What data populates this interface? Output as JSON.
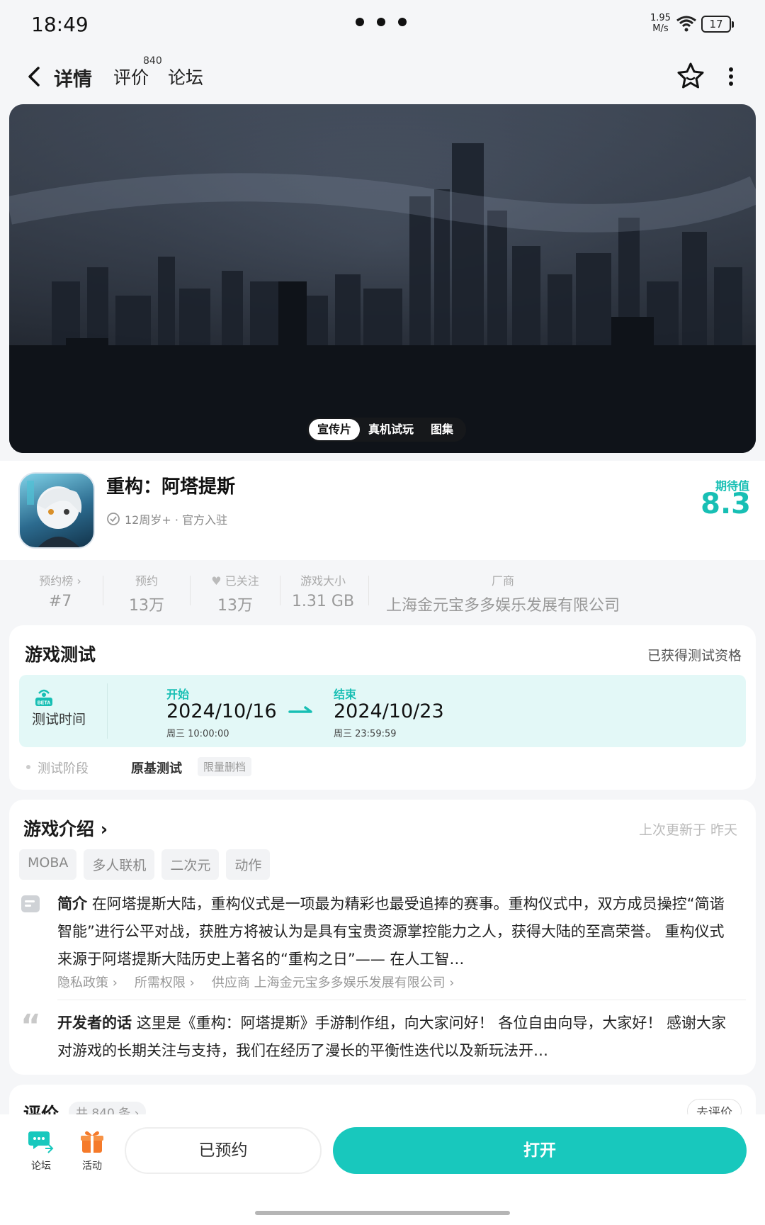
{
  "status": {
    "time": "18:49",
    "net_speed_top": "1.95",
    "net_speed_bottom": "M/s",
    "battery": "17"
  },
  "nav": {
    "tab_detail": "详情",
    "tab_review": "评价",
    "review_count": "840",
    "tab_forum": "论坛"
  },
  "hero": {
    "chips": [
      "宣传片",
      "真机试玩",
      "图集"
    ]
  },
  "game": {
    "name": "重构：阿塔提斯",
    "meta": "12周岁+ · 官方入驻",
    "expect_label": "期待值",
    "expect_score": "8.3"
  },
  "stats": [
    {
      "label": "预约榜 ›",
      "value": "#7"
    },
    {
      "label": "预约",
      "value": "13万"
    },
    {
      "label": "已关注",
      "value": "13万"
    },
    {
      "label": "游戏大小",
      "value": "1.31 GB"
    },
    {
      "label": "厂商",
      "value": "上海金元宝多多娱乐发展有限公司"
    }
  ],
  "test": {
    "title": "游戏测试",
    "qualification": "已获得测试资格",
    "time_label": "测试时间",
    "start_label": "开始",
    "start_date": "2024/10/16",
    "start_sub": "周三  10:00:00",
    "end_label": "结束",
    "end_date": "2024/10/23",
    "end_sub": "周三  23:59:59",
    "phase_label": "测试阶段",
    "phase_value": "原基测试",
    "phase_tag": "限量删档"
  },
  "intro": {
    "title": "游戏介绍 ›",
    "updated": "上次更新于 昨天",
    "tags": [
      "MOBA",
      "多人联机",
      "二次元",
      "动作"
    ],
    "summary_label": "简介",
    "summary_text": "在阿塔提斯大陆，重构仪式是一项最为精彩也最受追捧的赛事。重构仪式中，双方成员操控“简谐智能”进行公平对战，获胜方将被认为是具有宝贵资源掌控能力之人，获得大陆的至高荣誉。 重构仪式来源于阿塔提斯大陆历史上著名的“重构之日”—— 在人工智…",
    "links": [
      "隐私政策 ›",
      "所需权限 ›",
      "供应商 上海金元宝多多娱乐发展有限公司 ›"
    ],
    "dev_label": "开发者的话",
    "dev_text": "这里是《重构：阿塔提斯》手游制作组，向大家问好！ 各位自由向导，大家好！ 感谢大家对游戏的长期关注与支持，我们在经历了漫长的平衡性迭代以及新玩法开…"
  },
  "reviews": {
    "title": "评价",
    "count": "共 840 条 ›",
    "write": "去评价"
  },
  "bottom": {
    "forum": "论坛",
    "activity": "活动",
    "reserved": "已预约",
    "open": "打开"
  }
}
